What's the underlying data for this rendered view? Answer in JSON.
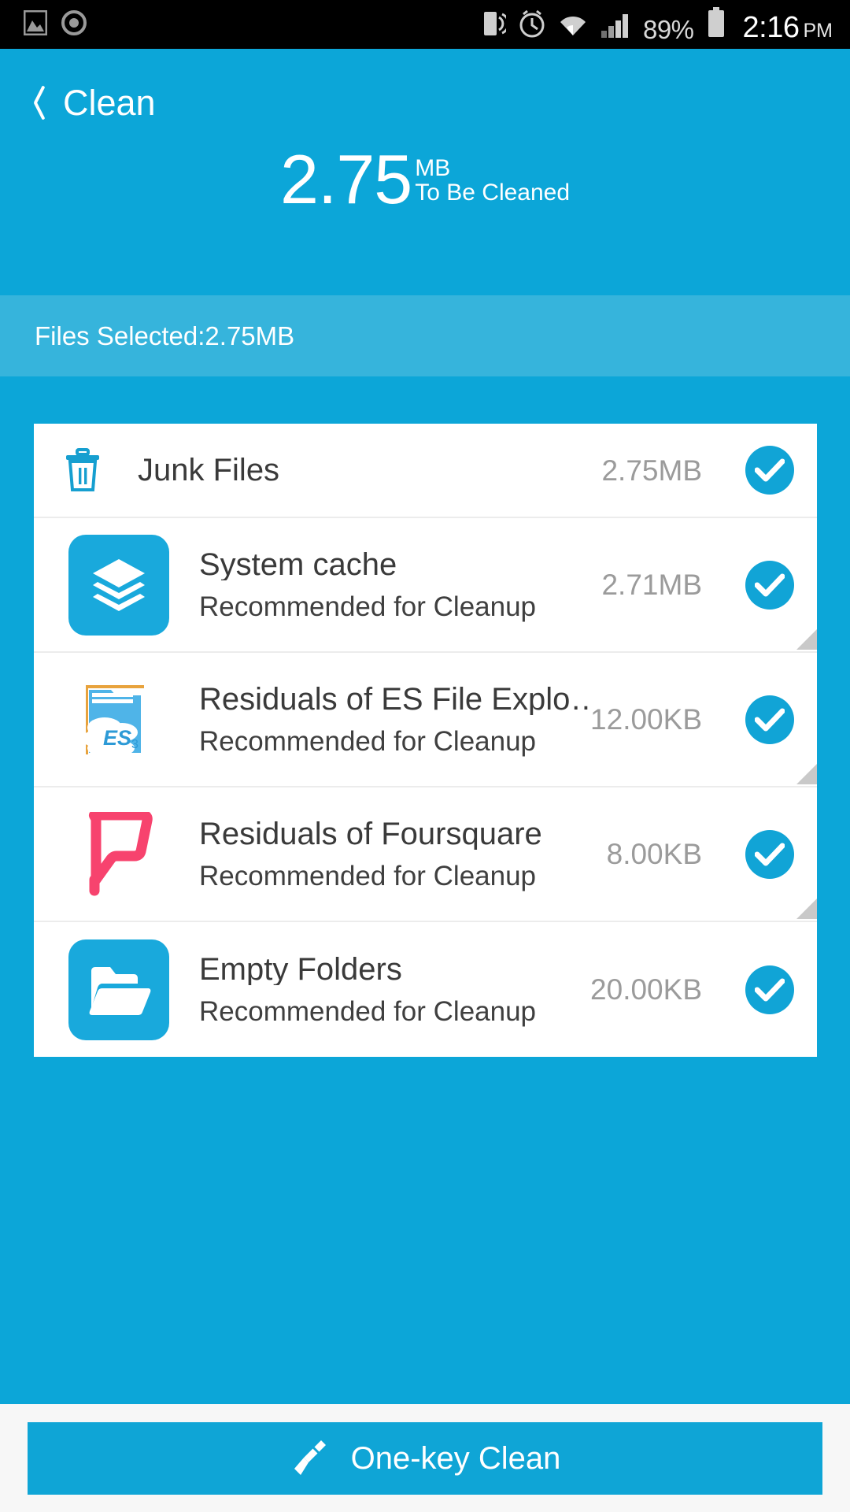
{
  "statusbar": {
    "battery_percent": "89%",
    "time": "2:16",
    "ampm": "PM",
    "icons": [
      "image-icon",
      "record-icon",
      "vibrate-icon",
      "alarm-icon",
      "wifi-icon",
      "signal-icon",
      "battery-icon"
    ]
  },
  "header": {
    "back_label": "Clean",
    "back_icon": "chevron-left-icon",
    "size_value": "2.75",
    "size_unit": "MB",
    "size_caption": "To Be Cleaned"
  },
  "selected_bar": {
    "text": "Files Selected:2.75MB"
  },
  "list": {
    "header_row": {
      "icon": "trash-icon",
      "label": "Junk Files",
      "size": "2.75MB",
      "checked": true
    },
    "items": [
      {
        "icon": "layers-icon",
        "title": "System cache",
        "subtitle": "Recommended for Cleanup",
        "size": "2.71MB",
        "checked": true,
        "expandable": true
      },
      {
        "icon": "es-file-explorer-icon",
        "title": "Residuals of ES File Explo…",
        "subtitle": "Recommended for Cleanup",
        "size": "12.00KB",
        "checked": true,
        "expandable": true
      },
      {
        "icon": "foursquare-icon",
        "title": "Residuals of Foursquare",
        "subtitle": "Recommended for Cleanup",
        "size": "8.00KB",
        "checked": true,
        "expandable": true
      },
      {
        "icon": "folder-open-icon",
        "title": "Empty Folders",
        "subtitle": "Recommended for Cleanup",
        "size": "20.00KB",
        "checked": true,
        "expandable": false
      }
    ]
  },
  "bottom": {
    "button_label": "One-key Clean",
    "button_icon": "broom-icon"
  },
  "colors": {
    "accent": "#0CA6D8",
    "accent_light": "#36B4DC",
    "card": "#ffffff",
    "foursquare": "#F7436E"
  }
}
